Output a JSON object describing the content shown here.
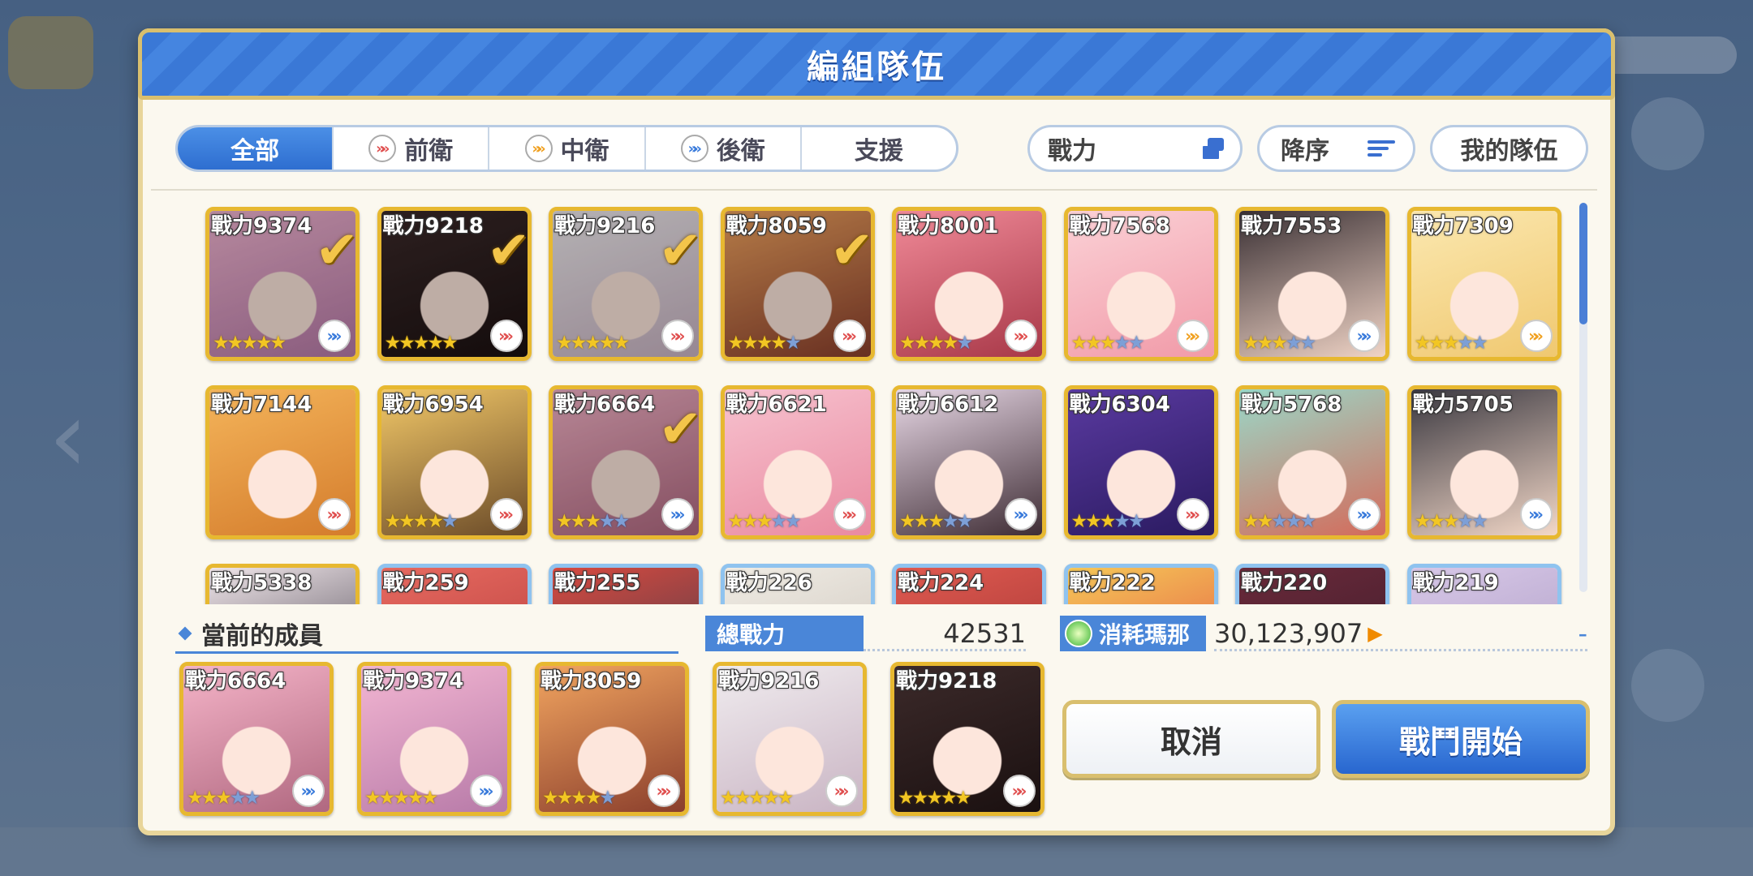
{
  "dialog": {
    "title": "編組隊伍"
  },
  "filters": {
    "tabs": [
      {
        "label": "全部",
        "active": true,
        "icon": ""
      },
      {
        "label": "前衛",
        "active": false,
        "icon": "front-role-icon"
      },
      {
        "label": "中衛",
        "active": false,
        "icon": "mid-role-icon"
      },
      {
        "label": "後衛",
        "active": false,
        "icon": "back-role-icon"
      },
      {
        "label": "支援",
        "active": false,
        "icon": ""
      }
    ],
    "sort_field": "戰力",
    "sort_order": "降序",
    "my_team": "我的隊伍"
  },
  "roster": [
    {
      "power": "戰力9374",
      "stars": 5,
      "max_stars": 5,
      "role": "back",
      "selected": true,
      "frame": "gold",
      "tone": [
        "#f3b6d2",
        "#b77aa8"
      ]
    },
    {
      "power": "戰力9218",
      "stars": 5,
      "max_stars": 5,
      "role": "front",
      "selected": true,
      "frame": "gold",
      "tone": [
        "#3c2a2a",
        "#1a1010"
      ]
    },
    {
      "power": "戰力9216",
      "stars": 5,
      "max_stars": 5,
      "role": "front",
      "selected": true,
      "frame": "gold",
      "tone": [
        "#f0ecef",
        "#c9b4c3"
      ]
    },
    {
      "power": "戰力8059",
      "stars": 4,
      "max_stars": 5,
      "role": "front",
      "selected": true,
      "frame": "gold",
      "tone": [
        "#f2a560",
        "#8a3e2c"
      ]
    },
    {
      "power": "戰力8001",
      "stars": 4,
      "max_stars": 5,
      "role": "front",
      "selected": false,
      "frame": "gold",
      "tone": [
        "#f08a98",
        "#a83848"
      ]
    },
    {
      "power": "戰力7568",
      "stars": 3,
      "max_stars": 5,
      "role": "mid",
      "selected": false,
      "frame": "gold",
      "tone": [
        "#fbd1d6",
        "#f19aa8"
      ]
    },
    {
      "power": "戰力7553",
      "stars": 3,
      "max_stars": 5,
      "role": "back",
      "selected": false,
      "frame": "gold",
      "tone": [
        "#3a3034",
        "#f0d4c6"
      ]
    },
    {
      "power": "戰力7309",
      "stars": 3,
      "max_stars": 5,
      "role": "mid",
      "selected": false,
      "frame": "gold",
      "tone": [
        "#fbe8b0",
        "#f0c870"
      ]
    },
    {
      "power": "戰力7144",
      "stars": 0,
      "max_stars": 0,
      "role": "front",
      "selected": false,
      "frame": "gold",
      "tone": [
        "#f4b45a",
        "#d47c2c"
      ]
    },
    {
      "power": "戰力6954",
      "stars": 4,
      "max_stars": 5,
      "role": "front",
      "selected": false,
      "frame": "gold",
      "tone": [
        "#f2c868",
        "#6a4a28"
      ]
    },
    {
      "power": "戰力6664",
      "stars": 3,
      "max_stars": 5,
      "role": "back",
      "selected": true,
      "frame": "gold",
      "tone": [
        "#f5b4c8",
        "#b06880"
      ]
    },
    {
      "power": "戰力6621",
      "stars": 3,
      "max_stars": 5,
      "role": "front",
      "selected": false,
      "frame": "gold",
      "tone": [
        "#f7c2cf",
        "#e98aa0"
      ]
    },
    {
      "power": "戰力6612",
      "stars": 3,
      "max_stars": 5,
      "role": "back",
      "selected": false,
      "frame": "gold",
      "tone": [
        "#e8d8e6",
        "#3e2c34"
      ]
    },
    {
      "power": "戰力6304",
      "stars": 3,
      "max_stars": 5,
      "role": "front",
      "selected": false,
      "frame": "gold",
      "tone": [
        "#5a3aa0",
        "#2a1a60"
      ]
    },
    {
      "power": "戰力5768",
      "stars": 2,
      "max_stars": 5,
      "role": "back",
      "selected": false,
      "frame": "gold",
      "tone": [
        "#9ad8c8",
        "#d46a5a"
      ]
    },
    {
      "power": "戰力5705",
      "stars": 3,
      "max_stars": 5,
      "role": "back",
      "selected": false,
      "frame": "gold",
      "tone": [
        "#3a3840",
        "#f3d8c8"
      ]
    },
    {
      "power": "戰力5338",
      "stars": 0,
      "max_stars": 0,
      "role": "",
      "selected": false,
      "frame": "gold",
      "tone": [
        "#f0e6ea",
        "#3a3440"
      ]
    },
    {
      "power": "戰力259",
      "stars": 0,
      "max_stars": 0,
      "role": "",
      "selected": false,
      "frame": "blue",
      "tone": [
        "#e86a60",
        "#b03a3a"
      ]
    },
    {
      "power": "戰力255",
      "stars": 0,
      "max_stars": 0,
      "role": "",
      "selected": false,
      "frame": "blue",
      "tone": [
        "#d84a40",
        "#3a3a4a"
      ]
    },
    {
      "power": "戰力226",
      "stars": 0,
      "max_stars": 0,
      "role": "",
      "selected": false,
      "frame": "blue",
      "tone": [
        "#f0ece4",
        "#c8c0b8"
      ]
    },
    {
      "power": "戰力224",
      "stars": 0,
      "max_stars": 0,
      "role": "",
      "selected": false,
      "frame": "blue",
      "tone": [
        "#e05a50",
        "#9a3030"
      ]
    },
    {
      "power": "戰力222",
      "stars": 0,
      "max_stars": 0,
      "role": "",
      "selected": false,
      "frame": "blue",
      "tone": [
        "#f6c858",
        "#e04a40"
      ]
    },
    {
      "power": "戰力220",
      "stars": 0,
      "max_stars": 0,
      "role": "",
      "selected": false,
      "frame": "blue",
      "tone": [
        "#6a2a3a",
        "#3a1a2a"
      ]
    },
    {
      "power": "戰力219",
      "stars": 0,
      "max_stars": 0,
      "role": "",
      "selected": false,
      "frame": "blue",
      "tone": [
        "#d8c8e8",
        "#a898c0"
      ]
    }
  ],
  "members": {
    "label": "當前的成員",
    "list": [
      {
        "power": "戰力6664",
        "stars": 3,
        "max_stars": 5,
        "role": "back",
        "tone": [
          "#f5b4c8",
          "#b06880"
        ]
      },
      {
        "power": "戰力9374",
        "stars": 5,
        "max_stars": 5,
        "role": "back",
        "tone": [
          "#f3b6d2",
          "#b77aa8"
        ]
      },
      {
        "power": "戰力8059",
        "stars": 4,
        "max_stars": 5,
        "role": "front",
        "tone": [
          "#f2a560",
          "#8a3e2c"
        ]
      },
      {
        "power": "戰力9216",
        "stars": 5,
        "max_stars": 5,
        "role": "front",
        "tone": [
          "#f0ecef",
          "#c9b4c3"
        ]
      },
      {
        "power": "戰力9218",
        "stars": 5,
        "max_stars": 5,
        "role": "front",
        "tone": [
          "#3c2a2a",
          "#1a1010"
        ]
      }
    ]
  },
  "stats": {
    "total_power_label": "總戰力",
    "total_power_value": "42531",
    "mana_label": "消耗瑪那",
    "mana_value": "30,123,907",
    "mana_cost": "-"
  },
  "actions": {
    "cancel": "取消",
    "start": "戰鬥開始"
  },
  "colors": {
    "accent_blue": "#3a78d6",
    "gold_frame": "#e7b830",
    "check_gold": "#f3c54a"
  }
}
